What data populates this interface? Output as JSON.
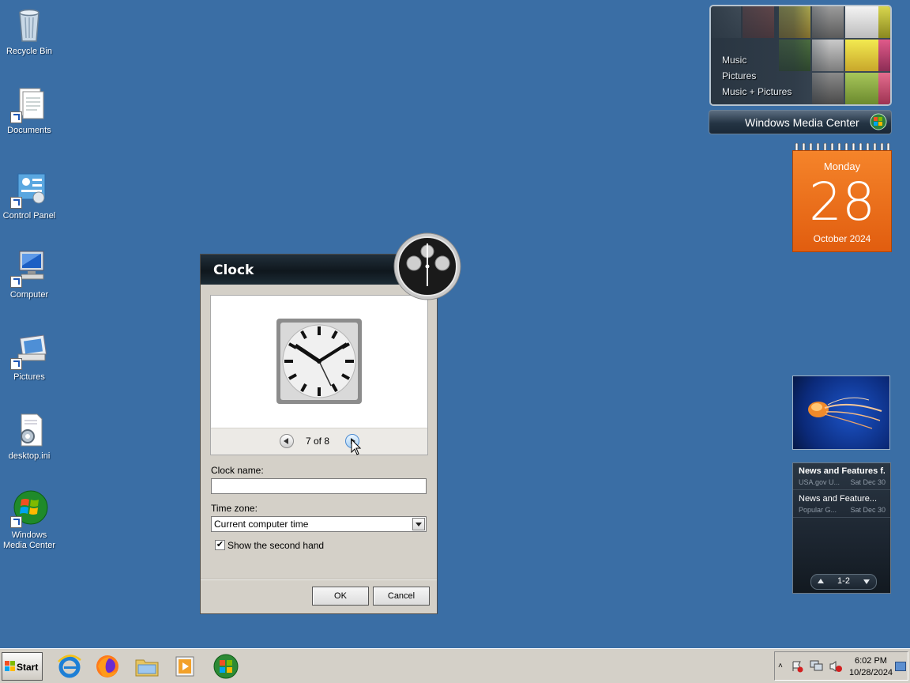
{
  "desktop": {
    "icons": [
      {
        "label": "Recycle Bin",
        "icon": "recycle-bin-icon"
      },
      {
        "label": "Documents",
        "icon": "documents-icon"
      },
      {
        "label": "Control Panel",
        "icon": "control-panel-icon"
      },
      {
        "label": "Computer",
        "icon": "computer-icon"
      },
      {
        "label": "Pictures",
        "icon": "pictures-icon"
      },
      {
        "label": "desktop.ini",
        "icon": "settings-file-icon"
      },
      {
        "label": "Windows\nMedia Center",
        "icon": "windows-logo-icon"
      }
    ]
  },
  "dialog": {
    "title": "Clock",
    "pager": "7 of 8",
    "clock_name_label": "Clock name:",
    "clock_name_value": "",
    "timezone_label": "Time zone:",
    "timezone_value": "Current computer time",
    "second_hand_label": "Show the second hand",
    "second_hand_checked": true,
    "ok": "OK",
    "cancel": "Cancel"
  },
  "media_center": {
    "items": [
      "Music",
      "Pictures",
      "Music + Pictures"
    ],
    "brand": "Windows Media Center"
  },
  "calendar": {
    "weekday": "Monday",
    "day": "28",
    "month_year": "October 2024",
    "color": "#e8701b"
  },
  "feeds": {
    "items": [
      {
        "title": "News and Features f...",
        "source": "USA.gov U...",
        "date": "Sat Dec 30"
      },
      {
        "title": "News and Feature...",
        "source": "Popular G...",
        "date": "Sat Dec 30"
      }
    ],
    "pager": "1-2"
  },
  "taskbar": {
    "start": "Start",
    "apps": [
      "internet-explorer-icon",
      "firefox-icon",
      "file-explorer-icon",
      "media-player-icon",
      "windows-logo-icon"
    ],
    "time": "6:02 PM",
    "date": "10/28/2024"
  }
}
